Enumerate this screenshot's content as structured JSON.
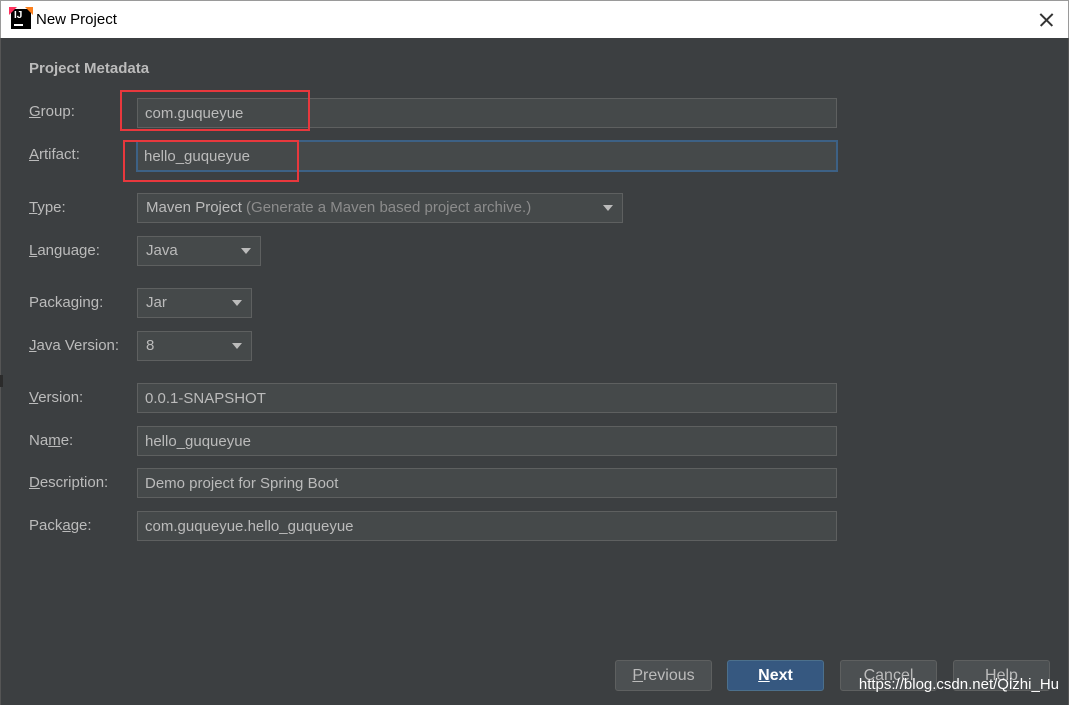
{
  "window": {
    "title": "New Project"
  },
  "section_title": "Project Metadata",
  "fields": {
    "group": {
      "label_pre": "",
      "label_u": "G",
      "label_post": "roup:",
      "value": "com.guqueyue"
    },
    "artifact": {
      "label_pre": "",
      "label_u": "A",
      "label_post": "rtifact:",
      "value": "hello_guqueyue"
    },
    "type": {
      "label_pre": "",
      "label_u": "T",
      "label_post": "ype:",
      "value": "Maven Project",
      "hint": " (Generate a Maven based project archive.)"
    },
    "language": {
      "label_pre": "",
      "label_u": "L",
      "label_post": "anguage:",
      "value": "Java"
    },
    "packaging": {
      "label_pre": "Packa",
      "label_u": "g",
      "label_post": "ing:",
      "value": "Jar"
    },
    "java_version": {
      "label_pre": "",
      "label_u": "J",
      "label_post": "ava Version:",
      "value": "8"
    },
    "version": {
      "label_pre": "",
      "label_u": "V",
      "label_post": "ersion:",
      "value": "0.0.1-SNAPSHOT"
    },
    "name": {
      "label_pre": "Na",
      "label_u": "m",
      "label_post": "e:",
      "value": "hello_guqueyue"
    },
    "description": {
      "label_pre": "",
      "label_u": "D",
      "label_post": "escription:",
      "value": "Demo project for Spring Boot"
    },
    "package": {
      "label_pre": "Pack",
      "label_u": "a",
      "label_post": "ge:",
      "value": "com.guqueyue.hello_guqueyue"
    }
  },
  "buttons": {
    "previous": {
      "u": "P",
      "rest": "revious"
    },
    "next": {
      "u": "N",
      "rest": "ext"
    },
    "cancel": {
      "u": "",
      "rest": "Cancel"
    },
    "help": {
      "u": "",
      "rest": "Help"
    }
  },
  "watermark": "https://blog.csdn.net/Qizhi_Hu",
  "colors": {
    "background": "#3c3f41",
    "field": "#45494a",
    "primary_button": "#365880",
    "highlight": "#e8383d",
    "focus": "#3d6185"
  }
}
